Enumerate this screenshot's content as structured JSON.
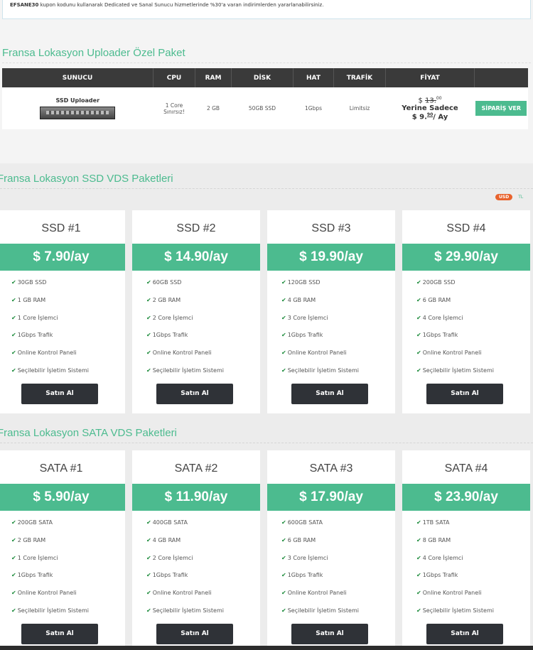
{
  "notice": {
    "code": "EFSANE30",
    "text": " kupon kodunu kullanarak Dedicated ve Sanal Sunucu hizmetlerinde %30'a varan indirimlerden yararlanabilirsiniz."
  },
  "uploader": {
    "title": "Fransa Lokasyon Uploader Özel Paket",
    "headers": [
      "SUNUCU",
      "CPU",
      "RAM",
      "DİSK",
      "HAT",
      "TRAFİK",
      "FİYAT"
    ],
    "row": {
      "name": "SSD Uploader",
      "cpu_line1": "1 Core",
      "cpu_line2": "Sınırsız!",
      "ram": "2 GB",
      "disk": "50GB SSD",
      "hat": "1Gbps",
      "trafik": "Limitsiz",
      "old_price_prefix": "$ ",
      "old_price_int": "13.",
      "old_price_dec": "00",
      "instead_label": "Yerine Sadece",
      "new_price_prefix": "$ 9.",
      "new_price_dec": "90",
      "new_price_suffix": "/ Ay",
      "order_label": "SİPARİŞ VER"
    }
  },
  "currency": {
    "usd": "USD",
    "tl": "TL"
  },
  "ssd": {
    "title": "Fransa Lokasyon SSD VDS Paketleri",
    "cards": [
      {
        "name": "SSD #1",
        "price": "$ 7.90/ay",
        "features": [
          "30GB SSD",
          "1 GB RAM",
          "1 Core İşlemci",
          "1Gbps Trafik",
          "Online Kontrol Paneli",
          "Seçilebilir İşletim Sistemi"
        ],
        "buy": "Satın Al"
      },
      {
        "name": "SSD #2",
        "price": "$ 14.90/ay",
        "features": [
          "60GB SSD",
          "2 GB RAM",
          "2 Core İşlemci",
          "1Gbps Trafik",
          "Online Kontrol Paneli",
          "Seçilebilir İşletim Sistemi"
        ],
        "buy": "Satın Al"
      },
      {
        "name": "SSD #3",
        "price": "$ 19.90/ay",
        "features": [
          "120GB SSD",
          "4 GB RAM",
          "3 Core İşlemci",
          "1Gbps Trafik",
          "Online Kontrol Paneli",
          "Seçilebilir İşletim Sistemi"
        ],
        "buy": "Satın Al"
      },
      {
        "name": "SSD #4",
        "price": "$ 29.90/ay",
        "features": [
          "200GB SSD",
          "6 GB RAM",
          "4 Core İşlemci",
          "1Gbps Trafik",
          "Online Kontrol Paneli",
          "Seçilebilir İşletim Sistemi"
        ],
        "buy": "Satın Al"
      }
    ]
  },
  "sata": {
    "title": "Fransa Lokasyon SATA VDS Paketleri",
    "cards": [
      {
        "name": "SATA #1",
        "price": "$ 5.90/ay",
        "features": [
          "200GB SATA",
          "2 GB RAM",
          "1 Core İşlemci",
          "1Gbps Trafik",
          "Online Kontrol Paneli",
          "Seçilebilir İşletim Sistemi"
        ],
        "buy": "Satın Al"
      },
      {
        "name": "SATA #2",
        "price": "$ 11.90/ay",
        "features": [
          "400GB SATA",
          "4 GB RAM",
          "2 Core İşlemci",
          "1Gbps Trafik",
          "Online Kontrol Paneli",
          "Seçilebilir İşletim Sistemi"
        ],
        "buy": "Satın Al"
      },
      {
        "name": "SATA #3",
        "price": "$ 17.90/ay",
        "features": [
          "600GB SATA",
          "6 GB RAM",
          "3 Core İşlemci",
          "1Gbps Trafik",
          "Online Kontrol Paneli",
          "Seçilebilir İşletim Sistemi"
        ],
        "buy": "Satın Al"
      },
      {
        "name": "SATA #4",
        "price": "$ 23.90/ay",
        "features": [
          "1TB SATA",
          "8 GB RAM",
          "4 Core İşlemci",
          "1Gbps Trafik",
          "Online Kontrol Paneli",
          "Seçilebilir İşletim Sistemi"
        ],
        "buy": "Satın Al"
      }
    ]
  }
}
